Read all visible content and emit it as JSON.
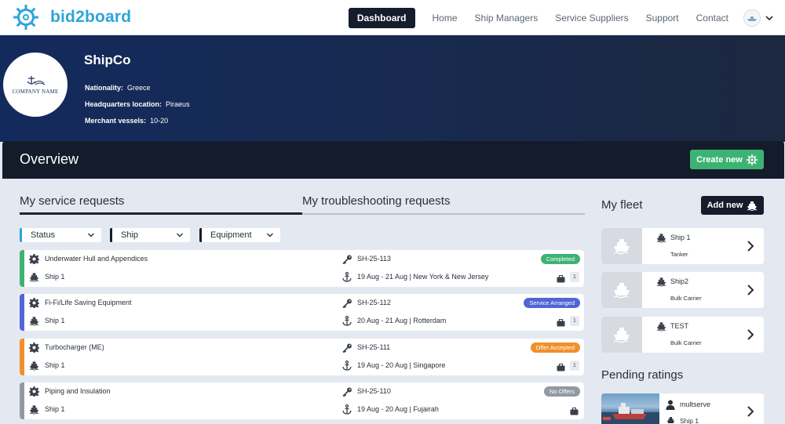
{
  "brand": {
    "name": "bid2board",
    "color": "#2fa4d9"
  },
  "nav": {
    "items": [
      "Dashboard",
      "Home",
      "Ship Managers",
      "Service Suppliers",
      "Support",
      "Contact"
    ],
    "active": "Dashboard"
  },
  "company": {
    "logo_text": "COMPANY NAME",
    "name": "ShipCo",
    "nationality_label": "Nationality:",
    "nationality": "Greece",
    "hq_label": "Headquarters location:",
    "hq": "Piraeus",
    "vessels_label": "Merchant vessels:",
    "vessels": "10-20"
  },
  "overview": {
    "title": "Overview",
    "create_label": "Create new",
    "create_color": "#3db373"
  },
  "tabs": {
    "service": "My service requests",
    "troubleshooting": "My troubleshooting requests",
    "active": "service"
  },
  "filters": [
    "Status",
    "Ship",
    "Equipment"
  ],
  "requests": [
    {
      "title": "Underwater Hull and Appendices",
      "ship": "Ship 1",
      "code": "SH-25-113",
      "details": "19 Aug - 21 Aug | New York & New Jersey",
      "status": "Completed",
      "status_color": "#3db373",
      "stripe_color": "#3db373",
      "count": "1",
      "icon": "gear-icon"
    },
    {
      "title": "Fi-Fi/Life Saving Equipment",
      "ship": "Ship 1",
      "code": "SH-25-112",
      "details": "20 Aug - 21 Aug | Rotterdam",
      "status": "Service Arranged",
      "status_color": "#5265d6",
      "stripe_color": "#5265d6",
      "count": "1",
      "icon": "gear-icon"
    },
    {
      "title": "Turbocharger (ME)",
      "ship": "Ship 1",
      "code": "SH-25-111",
      "details": "19 Aug - 20 Aug | Singapore",
      "status": "Offer Accepted",
      "status_color": "#f0902b",
      "stripe_color": "#f0902b",
      "count": "1",
      "icon": "gear-icon"
    },
    {
      "title": "Piping and Insulation",
      "ship": "Ship 1",
      "code": "SH-25-110",
      "details": "19 Aug - 20 Aug | Fujairah",
      "status": "No Offers",
      "status_color": "#9299a4",
      "stripe_color": "#9299a4",
      "count": "",
      "icon": "gear-icon"
    }
  ],
  "fleet": {
    "title": "My fleet",
    "add_label": "Add new",
    "ships": [
      {
        "name": "Ship 1",
        "type": "Tanker"
      },
      {
        "name": "Ship2",
        "type": "Bulk Carrier"
      },
      {
        "name": "TEST",
        "type": "Bulk Carrier"
      }
    ]
  },
  "pending": {
    "title": "Pending ratings",
    "items": [
      {
        "supplier": "multserve",
        "ship": "Ship 1"
      }
    ]
  }
}
